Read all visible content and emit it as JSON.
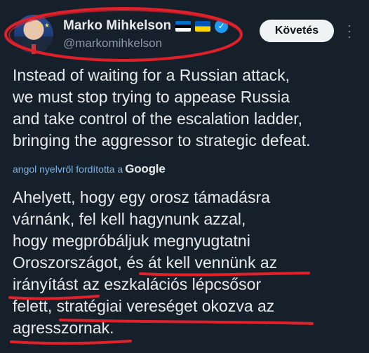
{
  "author": {
    "display_name": "Marko Mihkelson",
    "handle": "@markomihkelson",
    "flags": [
      "estonia-flag",
      "ukraine-flag"
    ],
    "verified_icon": "verified-badge-icon"
  },
  "actions": {
    "follow_label": "Követés",
    "more_icon": "more-options-icon"
  },
  "post": {
    "original_lines": [
      "Instead of waiting for a Russian attack,",
      "we must stop trying to appease Russia",
      "and take control of the escalation ladder,",
      "bringing the aggressor to strategic defeat."
    ],
    "translation_note": "angol nyelvről fordította a",
    "translation_provider": "Google",
    "translated_lines": [
      "Ahelyett, hogy egy orosz támadásra",
      "várnánk, fel kell hagynunk azzal,",
      "hogy megpróbáljuk megnyugtatni",
      "Oroszországot, és át kell vennünk az",
      "irányítást az eszkalációs lépcsősor",
      "felett, stratégiai vereséget okozva az",
      "agresszornak."
    ]
  },
  "colors": {
    "background": "#15202b",
    "text": "#e7e9ea",
    "secondary": "#8b98a5",
    "link": "#7cb3e6",
    "annotation_red": "#e0202a"
  }
}
